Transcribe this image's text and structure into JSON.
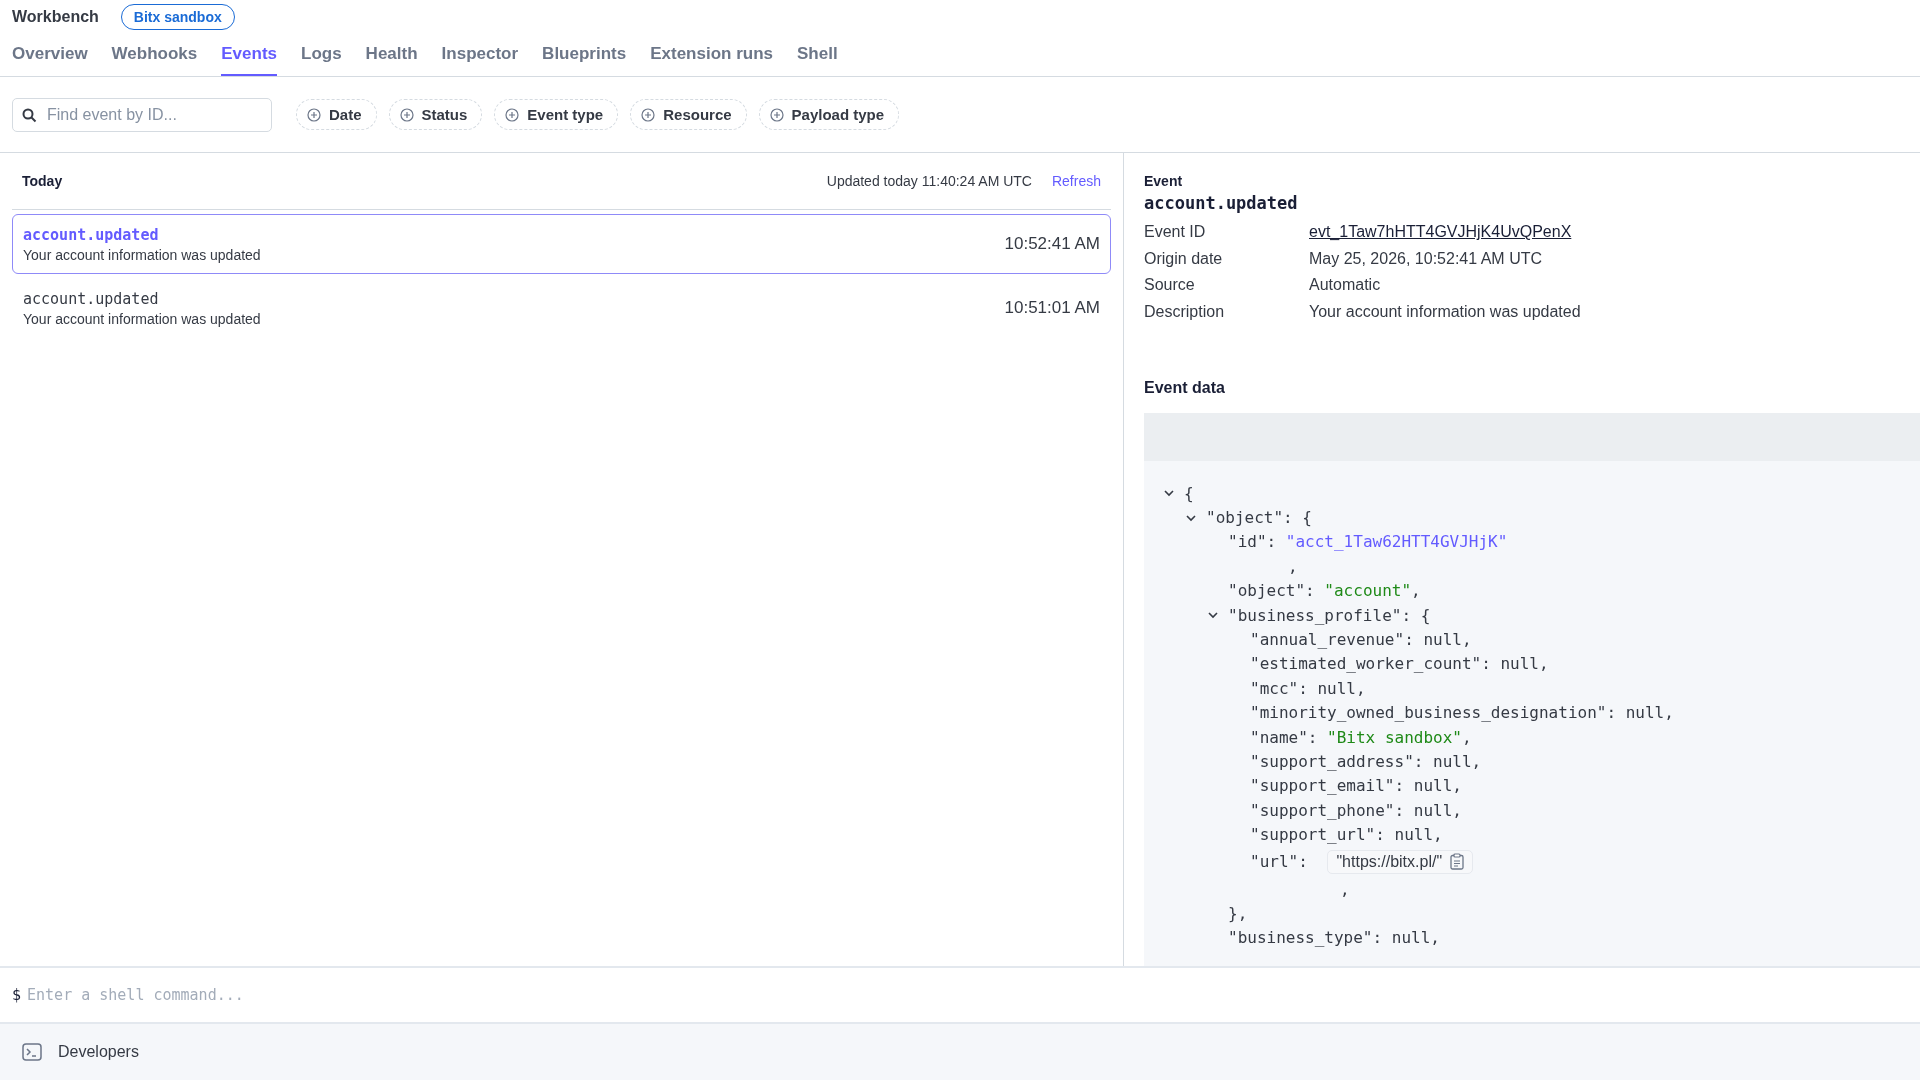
{
  "header": {
    "title": "Workbench",
    "badge": "Bitx sandbox"
  },
  "tabs": [
    {
      "label": "Overview",
      "selected": false
    },
    {
      "label": "Webhooks",
      "selected": false
    },
    {
      "label": "Events",
      "selected": true
    },
    {
      "label": "Logs",
      "selected": false
    },
    {
      "label": "Health",
      "selected": false
    },
    {
      "label": "Inspector",
      "selected": false
    },
    {
      "label": "Blueprints",
      "selected": false
    },
    {
      "label": "Extension runs",
      "selected": false
    },
    {
      "label": "Shell",
      "selected": false
    }
  ],
  "search": {
    "placeholder": "Find event by ID..."
  },
  "filters": [
    "Date",
    "Status",
    "Event type",
    "Resource",
    "Payload type"
  ],
  "event_list": {
    "group": "Today",
    "updated": "Updated today 11:40:24 AM UTC",
    "refresh": "Refresh",
    "events": [
      {
        "type": "account.updated",
        "description": "Your account information was updated",
        "time": "10:52:41 AM",
        "selected": true
      },
      {
        "type": "account.updated",
        "description": "Your account information was updated",
        "time": "10:51:01 AM",
        "selected": false
      }
    ]
  },
  "detail": {
    "label": "Event",
    "title": "account.updated",
    "fields": [
      {
        "label": "Event ID",
        "value": "evt_1Taw7hHTT4GVJHjK4UvQPenX",
        "kind": "link"
      },
      {
        "label": "Origin date",
        "value": "May 25, 2026, 10:52:41 AM UTC",
        "kind": "text"
      },
      {
        "label": "Source",
        "value": "Automatic",
        "kind": "text"
      },
      {
        "label": "Description",
        "value": "Your account information was updated",
        "kind": "text"
      }
    ],
    "data_heading": "Event data",
    "tree": {
      "open": "{",
      "expanded": true,
      "children": [
        {
          "key": "\"object\":",
          "open": "{",
          "expanded": true,
          "children": [
            {
              "key": "\"id\":",
              "value": "\"acct_1Taw62HTT4GVJHjK\"",
              "kind": "id",
              "comma": ","
            },
            {
              "key": "\"object\":",
              "value": "\"account\"",
              "kind": "string",
              "comma": ","
            },
            {
              "key": "\"business_profile\":",
              "open": "{",
              "expanded": true,
              "close": "},",
              "children": [
                {
                  "key": "\"annual_revenue\":",
                  "value": "null",
                  "kind": "null",
                  "comma": ","
                },
                {
                  "key": "\"estimated_worker_count\":",
                  "value": "null",
                  "kind": "null",
                  "comma": ","
                },
                {
                  "key": "\"mcc\":",
                  "value": "null",
                  "kind": "null",
                  "comma": ","
                },
                {
                  "key": "\"minority_owned_business_designation\":",
                  "value": "null",
                  "kind": "null",
                  "comma": ","
                },
                {
                  "key": "\"name\":",
                  "value": "\"Bitx sandbox\"",
                  "kind": "string",
                  "comma": ","
                },
                {
                  "key": "\"support_address\":",
                  "value": "null",
                  "kind": "null",
                  "comma": ","
                },
                {
                  "key": "\"support_email\":",
                  "value": "null",
                  "kind": "null",
                  "comma": ","
                },
                {
                  "key": "\"support_phone\":",
                  "value": "null",
                  "kind": "null",
                  "comma": ","
                },
                {
                  "key": "\"support_url\":",
                  "value": "null",
                  "kind": "null",
                  "comma": ","
                },
                {
                  "key": "\"url\":",
                  "value": "\"https://bitx.pl/\"",
                  "kind": "link",
                  "comma": ","
                }
              ]
            },
            {
              "key": "\"business_type\":",
              "value": "null",
              "kind": "null",
              "comma": ","
            }
          ]
        }
      ]
    }
  },
  "shell": {
    "prompt": "$",
    "placeholder": "Enter a shell command..."
  },
  "footer": {
    "label": "Developers"
  }
}
